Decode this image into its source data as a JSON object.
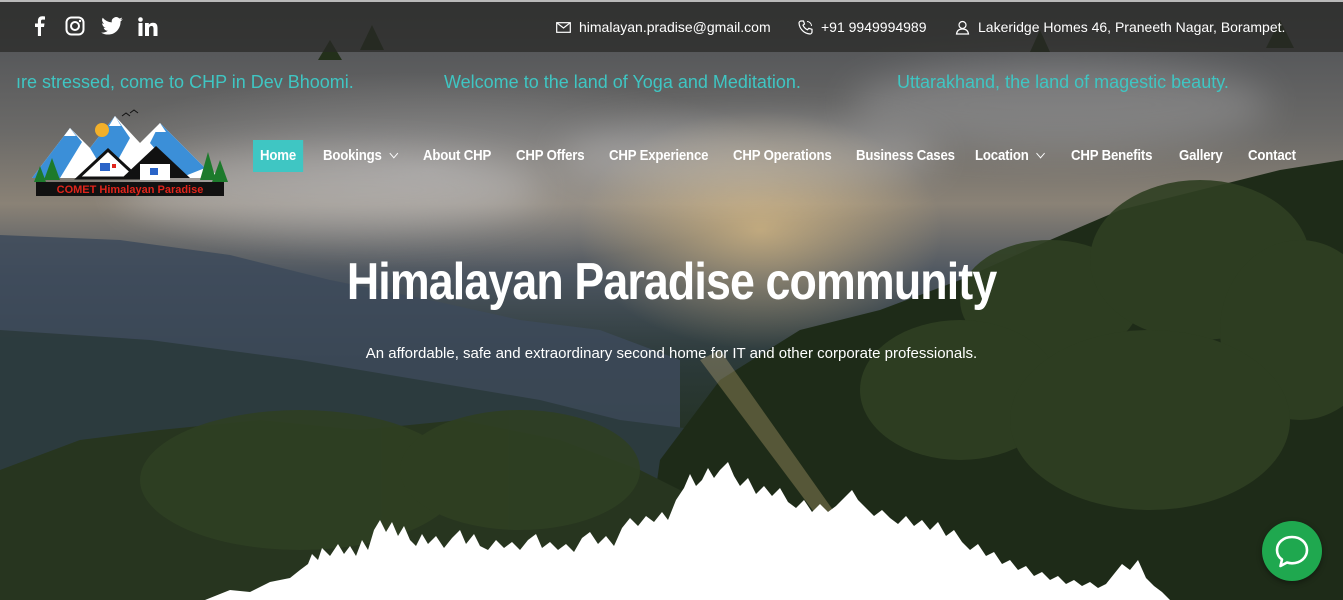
{
  "topbar": {
    "social_icons": [
      "facebook-icon",
      "instagram-icon",
      "twitter-icon",
      "linkedin-icon"
    ],
    "email": "himalayan.pradise@gmail.com",
    "phone": "+91 9949994989",
    "address": "Lakeridge Homes 46, Praneeth Nagar, Borampet."
  },
  "marquee": {
    "items": [
      "ıre stressed, come to CHP in Dev Bhoomi.",
      "Welcome to the land of Yoga and Meditation.",
      "Uttarakhand, the land of magestic beauty."
    ]
  },
  "logo": {
    "text": "COMET Himalayan Paradise"
  },
  "nav": {
    "items": [
      {
        "label": "Home",
        "active": true
      },
      {
        "label": "Bookings",
        "dropdown": true
      },
      {
        "label": "About CHP"
      },
      {
        "label": "CHP Offers"
      },
      {
        "label": "CHP Experience"
      },
      {
        "label": "CHP Operations"
      },
      {
        "label": "Business Cases"
      },
      {
        "label": "Location",
        "dropdown": true
      },
      {
        "label": "CHP Benefits"
      },
      {
        "label": "Gallery"
      },
      {
        "label": "Contact"
      }
    ]
  },
  "hero": {
    "title": "Himalayan Paradise community",
    "subtitle": "An affordable, safe and extraordinary second home for IT and other corporate professionals."
  },
  "colors": {
    "accent": "#3fc6c3",
    "chat": "#1fa84f",
    "logo_text": "#e0241b"
  },
  "chat": {
    "icon": "chat-bubble-icon"
  }
}
